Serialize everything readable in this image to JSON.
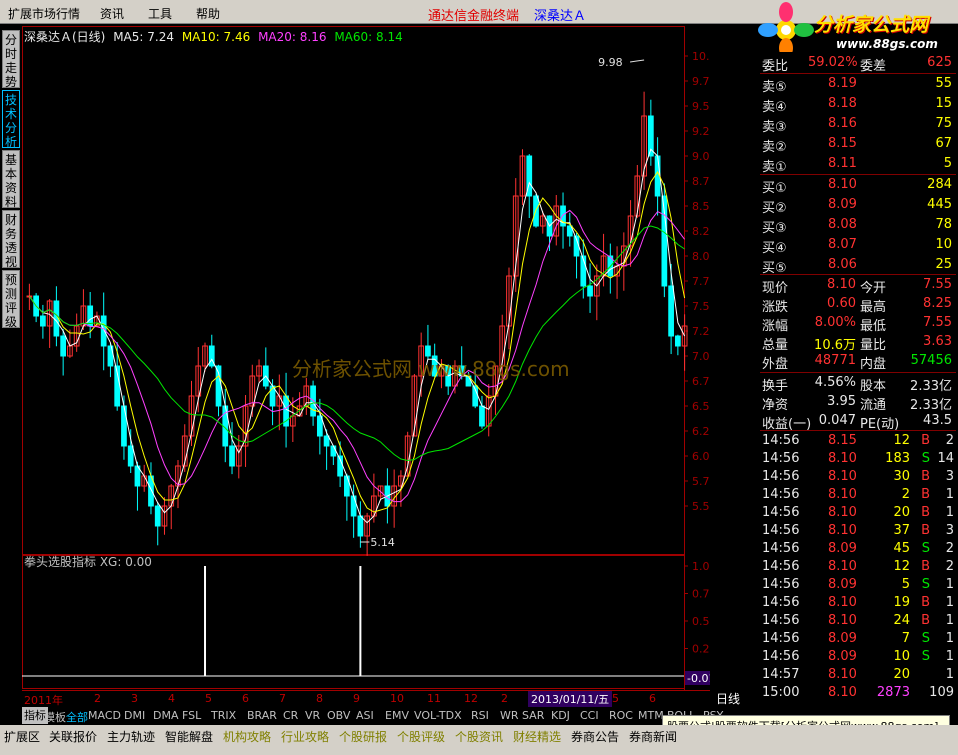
{
  "menu": {
    "items": [
      "扩展市场行情",
      "资讯",
      "工具",
      "帮助"
    ],
    "brand": "通达信金融终端",
    "stock_name": "深桑达Ａ"
  },
  "logo": {
    "text": "分析家公式网",
    "url": "www.88gs.com"
  },
  "left_tabs": [
    "分时走势",
    "技术分析",
    "基本资料",
    "财务透视",
    "预测评级"
  ],
  "ma_title": {
    "name": "深桑达Ａ(日线)",
    "ma5": "MA5: 7.24",
    "ma10": "MA10: 7.46",
    "ma20": "MA20: 8.16",
    "ma60": "MA60: 8.14"
  },
  "indicator_title": "拳头选股指标  XG: 0.00",
  "watermark": "分析家公式网 www.88gs.com",
  "price_axis": [
    "10.00",
    "9.75",
    "9.50",
    "9.25",
    "9.00",
    "8.75",
    "8.50",
    "8.25",
    "8.00",
    "7.75",
    "7.50",
    "7.25",
    "7.00",
    "6.75",
    "6.50",
    "6.25",
    "6.00",
    "5.75",
    "5.50"
  ],
  "ind_axis": [
    "1.00",
    "0.75",
    "0.50",
    "0.25"
  ],
  "ind_current": "-0.01",
  "high_label": "9.98",
  "low_label": "5.14",
  "quote": {
    "weibi_label": "委比",
    "weibi_value": "59.02%",
    "weicha_label": "委差",
    "weicha_value": "625",
    "sells": [
      {
        "label": "卖⑤",
        "price": "8.19",
        "vol": "55"
      },
      {
        "label": "卖④",
        "price": "8.18",
        "vol": "15"
      },
      {
        "label": "卖③",
        "price": "8.16",
        "vol": "75"
      },
      {
        "label": "卖②",
        "price": "8.15",
        "vol": "67"
      },
      {
        "label": "卖①",
        "price": "8.11",
        "vol": "5"
      }
    ],
    "buys": [
      {
        "label": "买①",
        "price": "8.10",
        "vol": "284"
      },
      {
        "label": "买②",
        "price": "8.09",
        "vol": "445"
      },
      {
        "label": "买③",
        "price": "8.08",
        "vol": "78"
      },
      {
        "label": "买④",
        "price": "8.07",
        "vol": "10"
      },
      {
        "label": "买⑤",
        "price": "8.06",
        "vol": "25"
      }
    ],
    "stats": [
      {
        "l1": "现价",
        "v1": "8.10",
        "c1": "red",
        "l2": "今开",
        "v2": "7.55",
        "c2": "red"
      },
      {
        "l1": "涨跌",
        "v1": "0.60",
        "c1": "red",
        "l2": "最高",
        "v2": "8.25",
        "c2": "red"
      },
      {
        "l1": "涨幅",
        "v1": "8.00%",
        "c1": "red",
        "l2": "最低",
        "v2": "7.55",
        "c2": "red"
      },
      {
        "l1": "总量",
        "v1": "10.6万",
        "c1": "yellow",
        "l2": "量比",
        "v2": "3.63",
        "c2": "red"
      },
      {
        "l1": "外盘",
        "v1": "48771",
        "c1": "red",
        "l2": "内盘",
        "v2": "57456",
        "c2": "green"
      }
    ],
    "fin": [
      {
        "l1": "换手",
        "v1": "4.56%",
        "l2": "股本",
        "v2": "2.33亿"
      },
      {
        "l1": "净资",
        "v1": "3.95",
        "l2": "流通",
        "v2": "2.33亿"
      },
      {
        "l1": "收益(一)",
        "v1": "0.047",
        "l2": "PE(动)",
        "v2": "43.5"
      }
    ]
  },
  "ticks": [
    {
      "time": "14:56",
      "price": "8.15",
      "pc": "red",
      "vol": "12",
      "vc": "yellow",
      "bs": "B",
      "bsc": "red",
      "n": "2"
    },
    {
      "time": "14:56",
      "price": "8.10",
      "pc": "red",
      "vol": "183",
      "vc": "yellow",
      "bs": "S",
      "bsc": "green",
      "n": "14"
    },
    {
      "time": "14:56",
      "price": "8.10",
      "pc": "red",
      "vol": "30",
      "vc": "yellow",
      "bs": "B",
      "bsc": "red",
      "n": "3"
    },
    {
      "time": "14:56",
      "price": "8.10",
      "pc": "red",
      "vol": "2",
      "vc": "yellow",
      "bs": "B",
      "bsc": "red",
      "n": "1"
    },
    {
      "time": "14:56",
      "price": "8.10",
      "pc": "red",
      "vol": "20",
      "vc": "yellow",
      "bs": "B",
      "bsc": "red",
      "n": "1"
    },
    {
      "time": "14:56",
      "price": "8.10",
      "pc": "red",
      "vol": "37",
      "vc": "yellow",
      "bs": "B",
      "bsc": "red",
      "n": "3"
    },
    {
      "time": "14:56",
      "price": "8.09",
      "pc": "red",
      "vol": "45",
      "vc": "yellow",
      "bs": "S",
      "bsc": "green",
      "n": "2"
    },
    {
      "time": "14:56",
      "price": "8.10",
      "pc": "red",
      "vol": "12",
      "vc": "yellow",
      "bs": "B",
      "bsc": "red",
      "n": "2"
    },
    {
      "time": "14:56",
      "price": "8.09",
      "pc": "red",
      "vol": "5",
      "vc": "yellow",
      "bs": "S",
      "bsc": "green",
      "n": "1"
    },
    {
      "time": "14:56",
      "price": "8.10",
      "pc": "red",
      "vol": "19",
      "vc": "yellow",
      "bs": "B",
      "bsc": "red",
      "n": "1"
    },
    {
      "time": "14:56",
      "price": "8.10",
      "pc": "red",
      "vol": "24",
      "vc": "yellow",
      "bs": "B",
      "bsc": "red",
      "n": "1"
    },
    {
      "time": "14:56",
      "price": "8.09",
      "pc": "red",
      "vol": "7",
      "vc": "yellow",
      "bs": "S",
      "bsc": "green",
      "n": "1"
    },
    {
      "time": "14:56",
      "price": "8.09",
      "pc": "red",
      "vol": "10",
      "vc": "yellow",
      "bs": "S",
      "bsc": "green",
      "n": "1"
    },
    {
      "time": "14:57",
      "price": "8.10",
      "pc": "red",
      "vol": "20",
      "vc": "yellow",
      "bs": "",
      "bsc": "red",
      "n": "1"
    },
    {
      "time": "15:00",
      "price": "8.10",
      "pc": "red",
      "vol": "2873",
      "vc": "magenta",
      "bs": "",
      "bsc": "red",
      "n": "109"
    }
  ],
  "date_axis": {
    "year": "2011年",
    "months": [
      "2",
      "3",
      "4",
      "5",
      "6",
      "7",
      "8",
      "9",
      "10",
      "11",
      "12",
      "2",
      "3",
      "4",
      "5",
      "6"
    ],
    "cursor_date": "2013/01/11/五",
    "period": "日线"
  },
  "tabs": [
    "指标",
    "模板",
    "全部",
    "MACD",
    "DMI",
    "DMA",
    "FSL",
    "TRIX",
    "BRAR",
    "CR",
    "VR",
    "OBV",
    "ASI",
    "EMV",
    "VOL-TDX",
    "RSI",
    "WR",
    "SAR",
    "KDJ",
    "CCI",
    "ROC",
    "MTM",
    "BOLL",
    "PSY"
  ],
  "ad_text": "股票公式|股票软件下载[分析家公式网www.88gs.com]",
  "bottom_tabs": [
    {
      "label": "扩展区",
      "color": "#000000"
    },
    {
      "label": "关联报价",
      "color": "#000000"
    },
    {
      "label": "主力轨迹",
      "color": "#000000"
    },
    {
      "label": "智能解盘",
      "color": "#000000"
    },
    {
      "label": "机构攻略",
      "color": "#808000"
    },
    {
      "label": "行业攻略",
      "color": "#808000"
    },
    {
      "label": "个股研报",
      "color": "#808000"
    },
    {
      "label": "个股评级",
      "color": "#808000"
    },
    {
      "label": "个股资讯",
      "color": "#808000"
    },
    {
      "label": "财经精选",
      "color": "#808000"
    },
    {
      "label": "券商公告",
      "color": "#000000"
    },
    {
      "label": "券商新闻",
      "color": "#000000"
    }
  ],
  "colors": {
    "up": "#ff3232",
    "down": "#00ffff",
    "ma5": "#ffffff",
    "ma10": "#ffff00",
    "ma20": "#ff40ff",
    "ma60": "#00e600",
    "axis": "#a00000"
  },
  "chart_data": {
    "type": "candlestick",
    "title": "深桑达Ａ(日线)",
    "ylim": [
      5.25,
      10.1
    ],
    "high": 9.98,
    "low": 5.14,
    "series": [
      {
        "name": "close",
        "values": [
          7.6,
          7.4,
          7.3,
          7.55,
          7.2,
          7.0,
          7.1,
          7.3,
          7.5,
          7.3,
          7.4,
          7.1,
          6.9,
          6.5,
          6.1,
          5.9,
          5.7,
          5.8,
          5.5,
          5.3,
          5.5,
          5.7,
          5.9,
          6.2,
          6.6,
          6.9,
          7.1,
          6.9,
          6.5,
          6.1,
          5.9,
          6.1,
          6.5,
          6.8,
          6.9,
          6.7,
          6.5,
          6.6,
          6.3,
          6.4,
          6.5,
          6.7,
          6.4,
          6.2,
          6.1,
          6.0,
          5.8,
          5.6,
          5.4,
          5.2,
          5.4,
          5.6,
          5.7,
          5.5,
          5.7,
          5.8,
          6.2,
          6.8,
          7.1,
          7.0,
          6.8,
          6.9,
          6.7,
          6.9,
          6.8,
          6.7,
          6.5,
          6.3,
          6.6,
          6.9,
          7.3,
          7.8,
          8.6,
          9.0,
          8.6,
          8.3,
          8.4,
          8.2,
          8.5,
          8.3,
          8.2,
          8.0,
          7.7,
          7.6,
          7.8,
          8.0,
          7.8,
          7.9,
          8.1,
          8.4,
          8.8,
          9.4,
          9.0,
          8.6,
          7.7,
          7.2,
          7.1,
          7.3
        ]
      },
      {
        "name": "XG",
        "values": [
          0,
          0,
          0,
          0,
          0,
          0,
          0,
          0,
          0,
          0,
          0,
          0,
          0,
          0,
          0,
          0,
          0,
          0,
          0,
          0,
          0,
          0,
          0,
          0,
          0,
          0,
          1,
          0,
          0,
          0,
          0,
          0,
          0,
          0,
          0,
          0,
          0,
          0,
          0,
          0,
          0,
          0,
          0,
          0,
          0,
          0,
          0,
          0,
          0,
          1,
          0,
          0,
          0,
          0,
          0,
          0,
          0,
          0,
          0,
          0,
          0,
          0,
          0,
          0,
          0,
          0,
          0,
          0,
          0,
          0,
          0,
          0,
          0,
          0,
          0,
          0,
          0,
          0,
          0,
          0,
          0,
          0,
          0,
          0,
          0,
          0,
          0,
          0,
          0,
          0,
          0,
          0,
          0,
          0,
          0,
          0,
          0,
          0
        ]
      }
    ]
  }
}
